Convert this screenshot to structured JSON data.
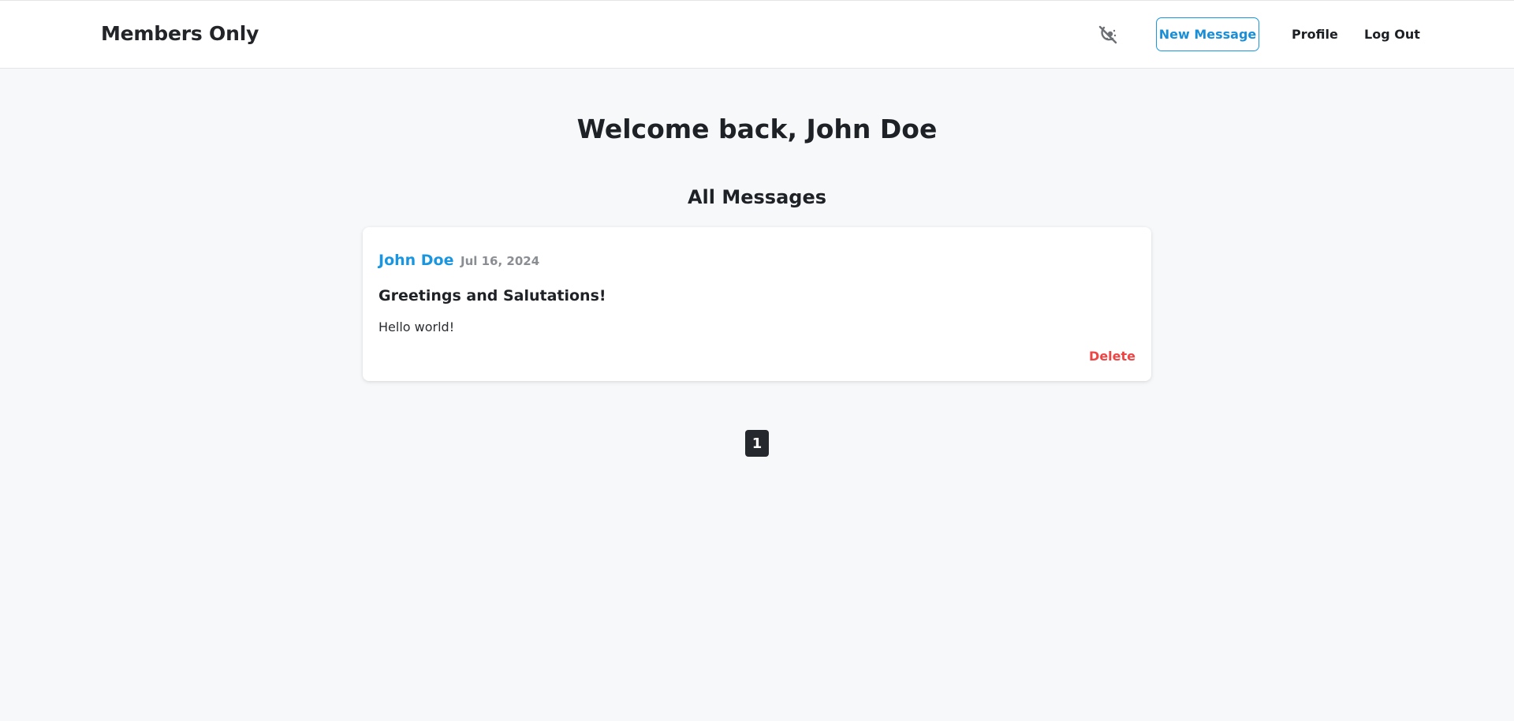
{
  "header": {
    "brand": "Members Only",
    "theme_toggle_icon": "theme-toggle-icon",
    "new_message_label": "New Message",
    "profile_label": "Profile",
    "logout_label": "Log Out"
  },
  "main": {
    "welcome": "Welcome back, John Doe",
    "section_title": "All Messages",
    "messages": [
      {
        "author": "John Doe",
        "date": "Jul 16, 2024",
        "title": "Greetings and Salutations!",
        "body": "Hello world!",
        "delete_label": "Delete"
      }
    ],
    "pagination": {
      "current_page": "1"
    }
  },
  "colors": {
    "accent": "#1a96e0",
    "danger": "#ef4444",
    "background": "#f7f8fa"
  }
}
